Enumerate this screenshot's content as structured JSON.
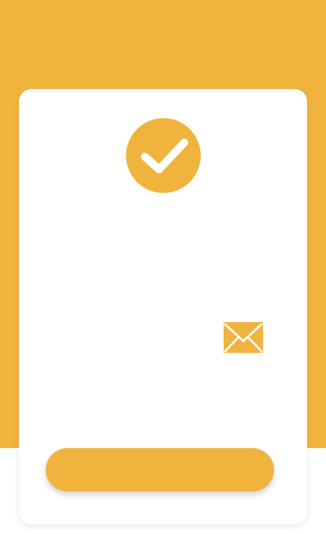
{
  "colors": {
    "accent": "#F0B43E",
    "card": "#FFFFFF",
    "page_bottom": "#FFFFFF"
  },
  "icons": {
    "status": "check-circle-icon",
    "mail": "mail-icon"
  },
  "success_card": {
    "button_label": ""
  }
}
